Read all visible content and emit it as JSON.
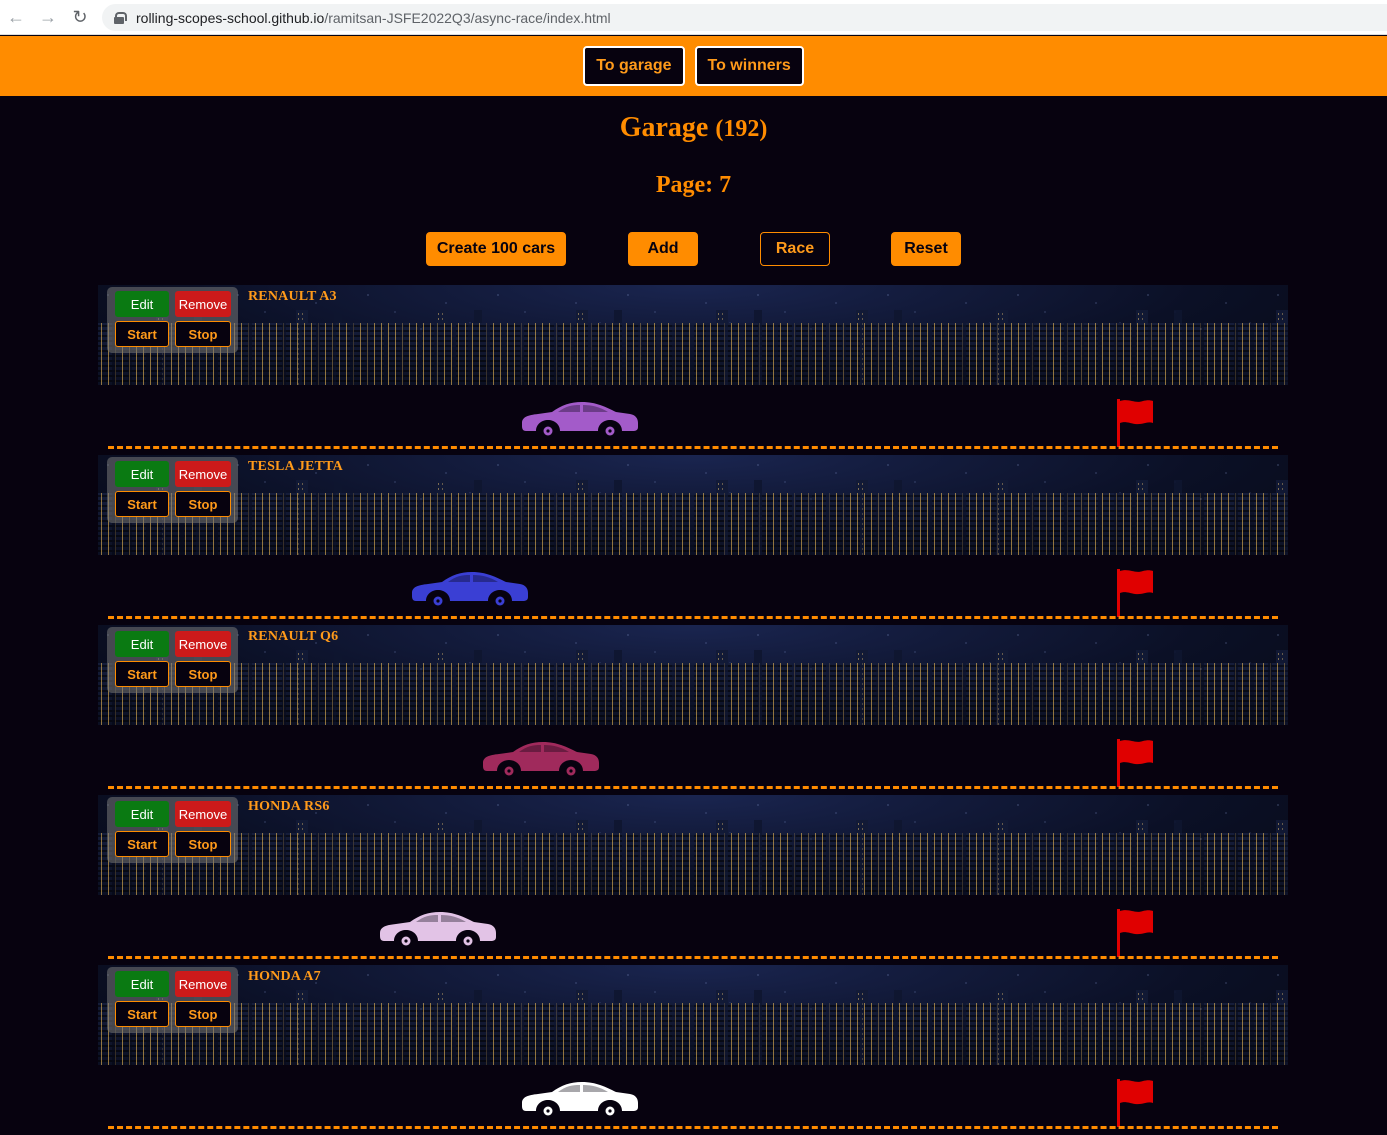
{
  "browser": {
    "url_host": "rolling-scopes-school.github.io",
    "url_path": "/ramitsan-JSFE2022Q3/async-race/index.html"
  },
  "header": {
    "to_garage": "To garage",
    "to_winners": "To winners"
  },
  "garage": {
    "title": "Garage",
    "count": "(192)",
    "page_label": "Page: 7"
  },
  "controls": {
    "create": "Create 100 cars",
    "add": "Add",
    "race": "Race",
    "reset": "Reset"
  },
  "car_buttons": {
    "edit": "Edit",
    "remove": "Remove",
    "start": "Start",
    "stop": "Stop"
  },
  "cars": [
    {
      "name": "RENAULT A3",
      "color": "#a35bc9"
    },
    {
      "name": "TESLA JETTA",
      "color": "#3a3fd4"
    },
    {
      "name": "RENAULT Q6",
      "color": "#a02a5c"
    },
    {
      "name": "HONDA RS6",
      "color": "#e2c3e6"
    },
    {
      "name": "HONDA A7",
      "color": "#ffffff"
    }
  ],
  "colors": {
    "accent": "#ff8c00",
    "background": "#07020f",
    "edit": "#0a7a12",
    "remove": "#cc1a1a",
    "flag": "#e00000"
  }
}
